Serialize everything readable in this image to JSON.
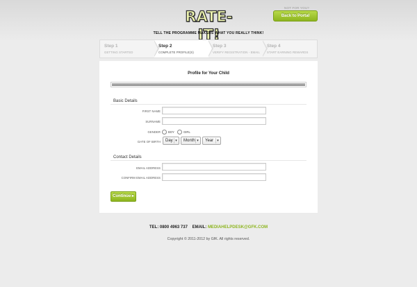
{
  "header": {
    "logo_text": "RATE-IT!",
    "not_you": "NOT FOR YOU?",
    "portal_button": "Back to Portal",
    "tagline": "TELL THE PROGRAMME MAKERS WHAT YOU REALLY THINK!"
  },
  "steps": [
    {
      "title": "Step 1",
      "subtitle": "GETTING STARTED"
    },
    {
      "title": "Step 2",
      "subtitle": "COMPLETE PROFILE(S)"
    },
    {
      "title": "Step 3",
      "subtitle": "VERIFY REGISTRATION - EMAIL"
    },
    {
      "title": "Step 4",
      "subtitle": "START EARNING REWARDS"
    }
  ],
  "form": {
    "title": "Profile for Your Child",
    "progress_fraction": 1.0,
    "basic_details": {
      "heading": "Basic Details",
      "first_name_label": "FIRST NAME",
      "first_name_value": "",
      "surname_label": "SURNAME",
      "surname_value": "",
      "gender_label": "GENDER",
      "gender_options": [
        "BOY",
        "GIRL"
      ],
      "dob_label": "DATE OF BIRTH",
      "dob_day": "Day",
      "dob_month": "Month",
      "dob_year": "Year"
    },
    "contact_details": {
      "heading": "Contact Details",
      "email_label": "EMAIL ADDRESS",
      "email_value": "",
      "confirm_email_label": "CONFIRM EMAIL ADDRESS",
      "confirm_email_value": ""
    },
    "continue_button": "Continue ▸"
  },
  "footer": {
    "tel_label": "TEL:",
    "tel_value": "0800 4963 737",
    "email_label": "EMAIL:",
    "email_value": "MEDIAHELPDESK@GFK.COM",
    "copyright": "Copyright © 2011-2012 by GfK. All rights reserved."
  },
  "colors": {
    "accent_green": "#8db51f",
    "background": "#ececec"
  }
}
